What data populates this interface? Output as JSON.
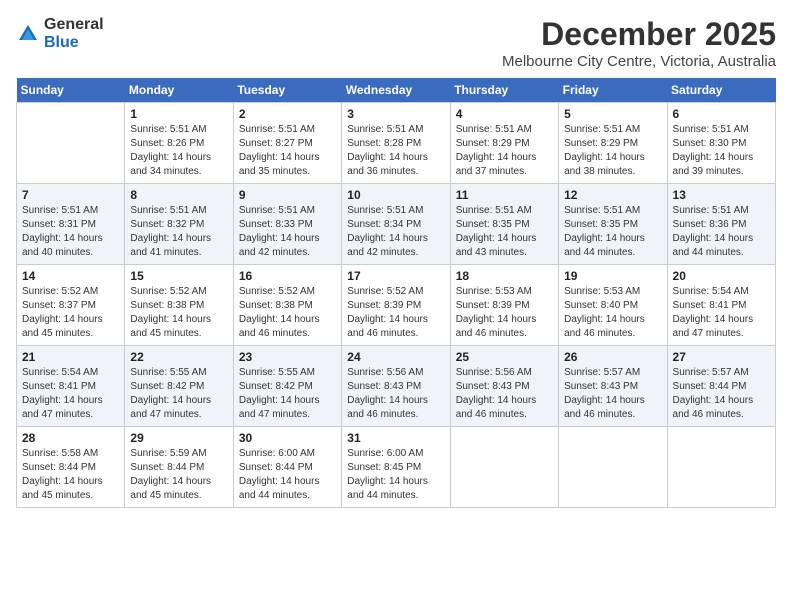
{
  "brand": {
    "name_general": "General",
    "name_blue": "Blue",
    "title": "December 2025",
    "subtitle": "Melbourne City Centre, Victoria, Australia"
  },
  "calendar": {
    "headers": [
      "Sunday",
      "Monday",
      "Tuesday",
      "Wednesday",
      "Thursday",
      "Friday",
      "Saturday"
    ],
    "rows": [
      [
        {
          "day": "",
          "sunrise": "",
          "sunset": "",
          "daylight": ""
        },
        {
          "day": "1",
          "sunrise": "Sunrise: 5:51 AM",
          "sunset": "Sunset: 8:26 PM",
          "daylight": "Daylight: 14 hours and 34 minutes."
        },
        {
          "day": "2",
          "sunrise": "Sunrise: 5:51 AM",
          "sunset": "Sunset: 8:27 PM",
          "daylight": "Daylight: 14 hours and 35 minutes."
        },
        {
          "day": "3",
          "sunrise": "Sunrise: 5:51 AM",
          "sunset": "Sunset: 8:28 PM",
          "daylight": "Daylight: 14 hours and 36 minutes."
        },
        {
          "day": "4",
          "sunrise": "Sunrise: 5:51 AM",
          "sunset": "Sunset: 8:29 PM",
          "daylight": "Daylight: 14 hours and 37 minutes."
        },
        {
          "day": "5",
          "sunrise": "Sunrise: 5:51 AM",
          "sunset": "Sunset: 8:29 PM",
          "daylight": "Daylight: 14 hours and 38 minutes."
        },
        {
          "day": "6",
          "sunrise": "Sunrise: 5:51 AM",
          "sunset": "Sunset: 8:30 PM",
          "daylight": "Daylight: 14 hours and 39 minutes."
        }
      ],
      [
        {
          "day": "7",
          "sunrise": "Sunrise: 5:51 AM",
          "sunset": "Sunset: 8:31 PM",
          "daylight": "Daylight: 14 hours and 40 minutes."
        },
        {
          "day": "8",
          "sunrise": "Sunrise: 5:51 AM",
          "sunset": "Sunset: 8:32 PM",
          "daylight": "Daylight: 14 hours and 41 minutes."
        },
        {
          "day": "9",
          "sunrise": "Sunrise: 5:51 AM",
          "sunset": "Sunset: 8:33 PM",
          "daylight": "Daylight: 14 hours and 42 minutes."
        },
        {
          "day": "10",
          "sunrise": "Sunrise: 5:51 AM",
          "sunset": "Sunset: 8:34 PM",
          "daylight": "Daylight: 14 hours and 42 minutes."
        },
        {
          "day": "11",
          "sunrise": "Sunrise: 5:51 AM",
          "sunset": "Sunset: 8:35 PM",
          "daylight": "Daylight: 14 hours and 43 minutes."
        },
        {
          "day": "12",
          "sunrise": "Sunrise: 5:51 AM",
          "sunset": "Sunset: 8:35 PM",
          "daylight": "Daylight: 14 hours and 44 minutes."
        },
        {
          "day": "13",
          "sunrise": "Sunrise: 5:51 AM",
          "sunset": "Sunset: 8:36 PM",
          "daylight": "Daylight: 14 hours and 44 minutes."
        }
      ],
      [
        {
          "day": "14",
          "sunrise": "Sunrise: 5:52 AM",
          "sunset": "Sunset: 8:37 PM",
          "daylight": "Daylight: 14 hours and 45 minutes."
        },
        {
          "day": "15",
          "sunrise": "Sunrise: 5:52 AM",
          "sunset": "Sunset: 8:38 PM",
          "daylight": "Daylight: 14 hours and 45 minutes."
        },
        {
          "day": "16",
          "sunrise": "Sunrise: 5:52 AM",
          "sunset": "Sunset: 8:38 PM",
          "daylight": "Daylight: 14 hours and 46 minutes."
        },
        {
          "day": "17",
          "sunrise": "Sunrise: 5:52 AM",
          "sunset": "Sunset: 8:39 PM",
          "daylight": "Daylight: 14 hours and 46 minutes."
        },
        {
          "day": "18",
          "sunrise": "Sunrise: 5:53 AM",
          "sunset": "Sunset: 8:39 PM",
          "daylight": "Daylight: 14 hours and 46 minutes."
        },
        {
          "day": "19",
          "sunrise": "Sunrise: 5:53 AM",
          "sunset": "Sunset: 8:40 PM",
          "daylight": "Daylight: 14 hours and 46 minutes."
        },
        {
          "day": "20",
          "sunrise": "Sunrise: 5:54 AM",
          "sunset": "Sunset: 8:41 PM",
          "daylight": "Daylight: 14 hours and 47 minutes."
        }
      ],
      [
        {
          "day": "21",
          "sunrise": "Sunrise: 5:54 AM",
          "sunset": "Sunset: 8:41 PM",
          "daylight": "Daylight: 14 hours and 47 minutes."
        },
        {
          "day": "22",
          "sunrise": "Sunrise: 5:55 AM",
          "sunset": "Sunset: 8:42 PM",
          "daylight": "Daylight: 14 hours and 47 minutes."
        },
        {
          "day": "23",
          "sunrise": "Sunrise: 5:55 AM",
          "sunset": "Sunset: 8:42 PM",
          "daylight": "Daylight: 14 hours and 47 minutes."
        },
        {
          "day": "24",
          "sunrise": "Sunrise: 5:56 AM",
          "sunset": "Sunset: 8:43 PM",
          "daylight": "Daylight: 14 hours and 46 minutes."
        },
        {
          "day": "25",
          "sunrise": "Sunrise: 5:56 AM",
          "sunset": "Sunset: 8:43 PM",
          "daylight": "Daylight: 14 hours and 46 minutes."
        },
        {
          "day": "26",
          "sunrise": "Sunrise: 5:57 AM",
          "sunset": "Sunset: 8:43 PM",
          "daylight": "Daylight: 14 hours and 46 minutes."
        },
        {
          "day": "27",
          "sunrise": "Sunrise: 5:57 AM",
          "sunset": "Sunset: 8:44 PM",
          "daylight": "Daylight: 14 hours and 46 minutes."
        }
      ],
      [
        {
          "day": "28",
          "sunrise": "Sunrise: 5:58 AM",
          "sunset": "Sunset: 8:44 PM",
          "daylight": "Daylight: 14 hours and 45 minutes."
        },
        {
          "day": "29",
          "sunrise": "Sunrise: 5:59 AM",
          "sunset": "Sunset: 8:44 PM",
          "daylight": "Daylight: 14 hours and 45 minutes."
        },
        {
          "day": "30",
          "sunrise": "Sunrise: 6:00 AM",
          "sunset": "Sunset: 8:44 PM",
          "daylight": "Daylight: 14 hours and 44 minutes."
        },
        {
          "day": "31",
          "sunrise": "Sunrise: 6:00 AM",
          "sunset": "Sunset: 8:45 PM",
          "daylight": "Daylight: 14 hours and 44 minutes."
        },
        {
          "day": "",
          "sunrise": "",
          "sunset": "",
          "daylight": ""
        },
        {
          "day": "",
          "sunrise": "",
          "sunset": "",
          "daylight": ""
        },
        {
          "day": "",
          "sunrise": "",
          "sunset": "",
          "daylight": ""
        }
      ]
    ]
  }
}
